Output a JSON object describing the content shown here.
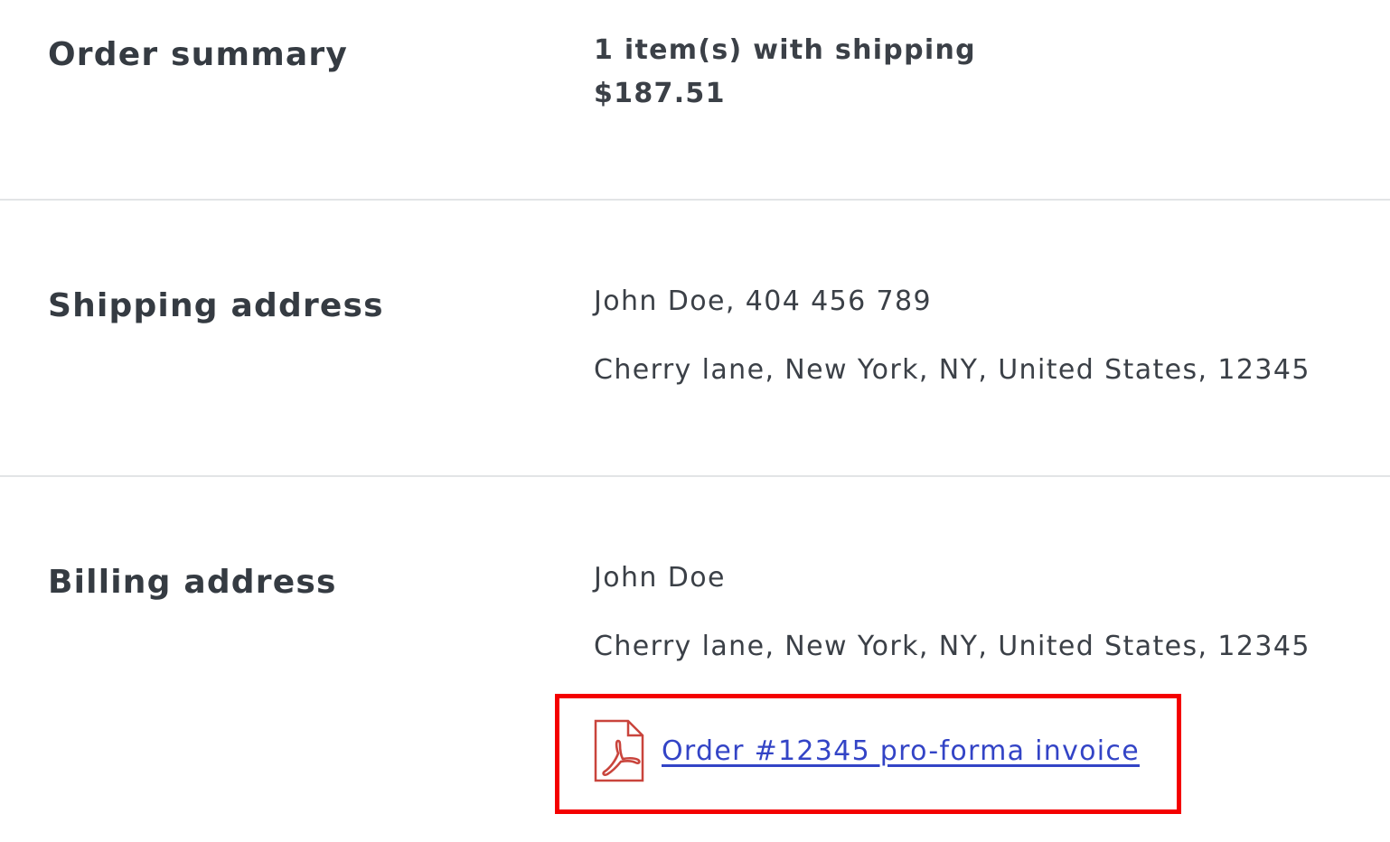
{
  "order_summary": {
    "label": "Order summary",
    "items_line": "1 item(s) with shipping",
    "total": "$187.51"
  },
  "shipping_address": {
    "label": "Shipping address",
    "name_phone": "John Doe, 404 456 789",
    "address": "Cherry lane, New York, NY, United States, 12345"
  },
  "billing_address": {
    "label": "Billing address",
    "name": "John Doe",
    "address": "Cherry lane, New York, NY, United States, 12345",
    "invoice_link": "Order #12345 pro-forma invoice",
    "invoice_icon": "pdf-file-icon"
  },
  "colors": {
    "link": "#3344c6",
    "highlight": "#f40000",
    "pdf_icon": "#c9443c",
    "divider": "#e2e4e6"
  }
}
